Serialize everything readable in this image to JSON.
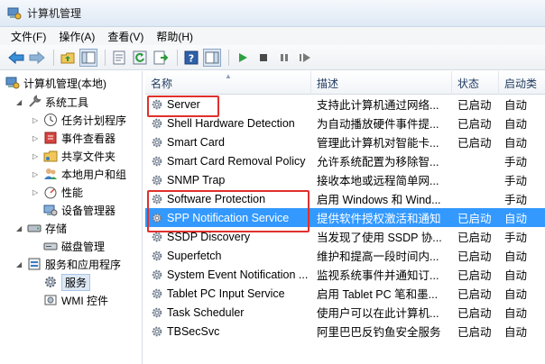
{
  "window": {
    "title": "计算机管理"
  },
  "menu": [
    "文件(F)",
    "操作(A)",
    "查看(V)",
    "帮助(H)"
  ],
  "toolbar_icons": [
    "back-icon",
    "forward-icon",
    "up-folder-icon",
    "show-tree-icon",
    "properties-icon",
    "refresh-icon",
    "export-icon",
    "help-icon",
    "action-pane-icon",
    "start-icon",
    "stop-icon",
    "pause-icon",
    "restart-icon"
  ],
  "tree": {
    "root": "计算机管理(本地)",
    "items": [
      {
        "label": "系统工具"
      },
      {
        "label": "任务计划程序"
      },
      {
        "label": "事件查看器"
      },
      {
        "label": "共享文件夹"
      },
      {
        "label": "本地用户和组"
      },
      {
        "label": "性能"
      },
      {
        "label": "设备管理器"
      },
      {
        "label": "存储"
      },
      {
        "label": "磁盘管理"
      },
      {
        "label": "服务和应用程序"
      },
      {
        "label": "服务"
      },
      {
        "label": "WMI 控件"
      }
    ]
  },
  "columns": [
    "名称",
    "描述",
    "状态",
    "启动类"
  ],
  "services": [
    {
      "name": "Server",
      "desc": "支持此计算机通过网络...",
      "status": "已启动",
      "start": "自动"
    },
    {
      "name": "Shell Hardware Detection",
      "desc": "为自动播放硬件事件提...",
      "status": "已启动",
      "start": "自动"
    },
    {
      "name": "Smart Card",
      "desc": "管理此计算机对智能卡...",
      "status": "已启动",
      "start": "自动"
    },
    {
      "name": "Smart Card Removal Policy",
      "desc": "允许系统配置为移除智...",
      "status": "",
      "start": "手动"
    },
    {
      "name": "SNMP Trap",
      "desc": "接收本地或远程简单网...",
      "status": "",
      "start": "手动"
    },
    {
      "name": "Software Protection",
      "desc": "启用 Windows 和 Wind...",
      "status": "",
      "start": "手动"
    },
    {
      "name": "SPP Notification Service",
      "desc": "提供软件授权激活和通知",
      "status": "已启动",
      "start": "自动"
    },
    {
      "name": "SSDP Discovery",
      "desc": "当发现了使用 SSDP 协...",
      "status": "已启动",
      "start": "手动"
    },
    {
      "name": "Superfetch",
      "desc": "维护和提高一段时间内...",
      "status": "已启动",
      "start": "自动"
    },
    {
      "name": "System Event Notification ...",
      "desc": "监视系统事件并通知订...",
      "status": "已启动",
      "start": "自动"
    },
    {
      "name": "Tablet PC Input Service",
      "desc": "启用 Tablet PC 笔和墨...",
      "status": "已启动",
      "start": "自动"
    },
    {
      "name": "Task Scheduler",
      "desc": "使用户可以在此计算机...",
      "status": "已启动",
      "start": "自动"
    },
    {
      "name": "TBSecSvc",
      "desc": "阿里巴巴反钓鱼安全服务",
      "status": "已启动",
      "start": "自动"
    }
  ],
  "selected_service": "SPP Notification Service",
  "colors": {
    "selection": "#3399ff",
    "highlight_box": "#e0302d"
  }
}
